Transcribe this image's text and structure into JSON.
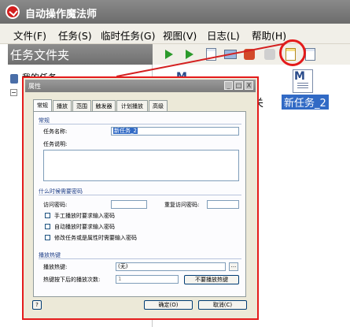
{
  "app": {
    "title": "自动操作魔法师"
  },
  "menu": [
    "文件(F)",
    "任务(S)",
    "临时任务(G)",
    "视图(V)",
    "日志(L)",
    "帮助(H)"
  ],
  "left_pane": {
    "header": "任务文件夹",
    "tree_label": "我的任务"
  },
  "task_list": {
    "item_label": "新任务_2",
    "partial_label": "关"
  },
  "dialog": {
    "title": "属性",
    "tabs": [
      "常规",
      "播放",
      "范围",
      "触发器",
      "计划播放",
      "高级"
    ],
    "general": {
      "header": "常规",
      "name_label": "任务名称:",
      "name_value": "新任务_2",
      "desc_label": "任务说明:"
    },
    "password": {
      "header": "什么时候需要密码",
      "access_label": "访问密码:",
      "confirm_label": "重复访问密码:",
      "options": [
        "手工播放时要求输入密码",
        "自动播放时要求输入密码",
        "修改任务或是属性时需要输入密码"
      ]
    },
    "hotkey": {
      "header": "播放热键",
      "hotkey_label": "播放热键:",
      "hotkey_value": "(无)",
      "browse": "...",
      "times_label": "热键按下后的播放次数:",
      "times_value": "1",
      "no_hotkey_button": "不要播放热键"
    },
    "help_button": "?",
    "ok_button": "确定(O)",
    "cancel_button": "取消(C)",
    "controls": [
      "_",
      "□",
      "X"
    ]
  },
  "colors": {
    "annotation_red": "#e41b1b",
    "selection_blue": "#316ac5",
    "title_grey": "#7c7c7c"
  }
}
